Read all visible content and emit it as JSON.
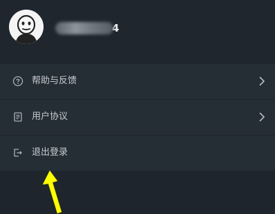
{
  "user": {
    "name_visible": "4"
  },
  "menu": {
    "items": [
      {
        "label": "帮助与反馈",
        "icon": "help-circle-icon",
        "chevron": true
      },
      {
        "label": "用户协议",
        "icon": "document-icon",
        "chevron": true
      },
      {
        "label": "退出登录",
        "icon": "logout-icon",
        "chevron": false
      }
    ]
  },
  "colors": {
    "background": "#1e252c",
    "menu_background": "#262e35",
    "text": "#c7ccd2",
    "annotation_arrow": "#ffff00"
  }
}
